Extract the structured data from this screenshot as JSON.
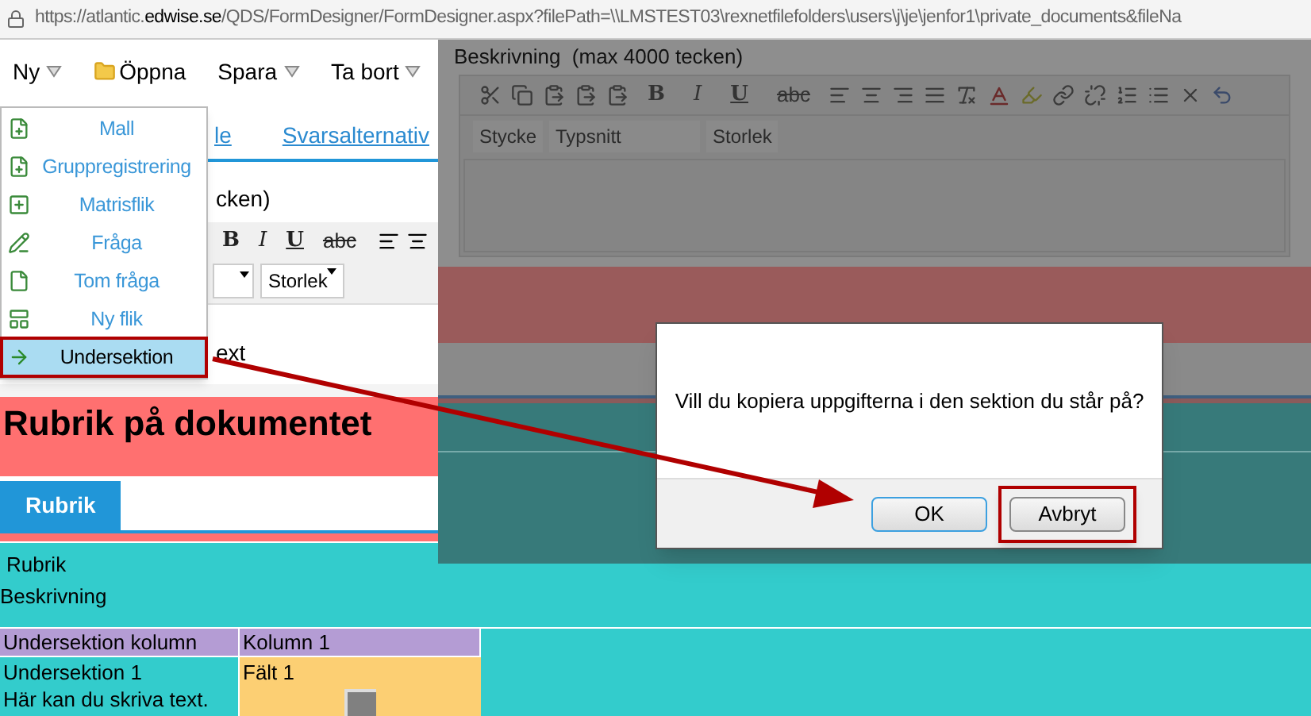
{
  "address_bar": {
    "before": "https://atlantic.",
    "domain": "edwise.se",
    "after": "/QDS/FormDesigner/FormDesigner.aspx?filePath=\\\\LMSTEST03\\rexnetfilefolders\\users\\j\\je\\jenfor1\\private_documents&fileNa"
  },
  "toolbar": [
    {
      "label": "Ny",
      "kind": "dropdown"
    },
    {
      "label": "Öppna",
      "kind": "folder"
    },
    {
      "label": "Spara",
      "kind": "dropdown"
    },
    {
      "label": "Ta bort",
      "kind": "dropdown"
    }
  ],
  "new_menu": [
    {
      "label": "Mall",
      "selected": false,
      "highlighted": false
    },
    {
      "label": "Gruppregistrering",
      "selected": false,
      "highlighted": false
    },
    {
      "label": "Matrisflik",
      "selected": false,
      "highlighted": false
    },
    {
      "label": "Fråga",
      "selected": false,
      "highlighted": false
    },
    {
      "label": "Tom fråga",
      "selected": false,
      "highlighted": false
    },
    {
      "label": "Ny flik",
      "selected": false,
      "highlighted": false
    },
    {
      "label": "Undersektion",
      "selected": true,
      "highlighted": true
    }
  ],
  "editor_tabs": [
    "le",
    "Svarsalternativ"
  ],
  "editor_label": "cken)",
  "format_buttons": [
    "B",
    "I",
    "U",
    "abc"
  ],
  "size_select": "Storlek",
  "editor_text": "ext",
  "heading": "Rubrik på dokumentet",
  "section_tabs": [
    {
      "label": "Rubrik",
      "selected": true
    }
  ],
  "section": {
    "title": "Rubrik",
    "description": "Beskrivning"
  },
  "table": {
    "columns": [
      "Undersektion kolumn",
      "Kolumn 1"
    ],
    "rows": [
      {
        "title": "Undersektion 1",
        "text": "Här kan du skriva text.",
        "field": "Fält 1"
      }
    ]
  },
  "background_editor": {
    "label": "Beskrivning  (max 4000 tecken)",
    "format_buttons": [
      "B",
      "I",
      "U",
      "abc"
    ],
    "selects": [
      "Stycke",
      "Typsnitt",
      "Storlek"
    ]
  },
  "dialog": {
    "message": "Vill du kopiera uppgifterna i den sektion du står på?",
    "buttons": [
      {
        "label": "OK",
        "focused": true,
        "highlighted": false
      },
      {
        "label": "Avbryt",
        "focused": false,
        "highlighted": true
      }
    ]
  }
}
